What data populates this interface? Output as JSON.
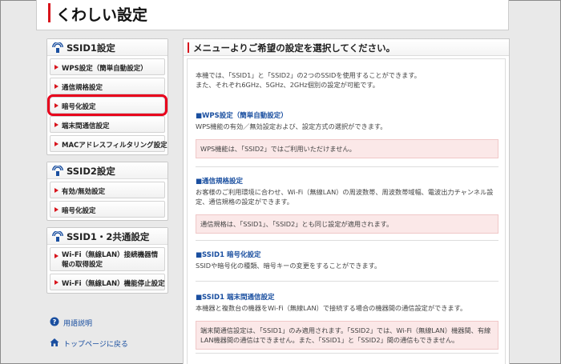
{
  "header": {
    "title": "くわしい設定"
  },
  "sidebar": {
    "ssid1": {
      "title": "SSID1設定",
      "items": [
        "WPS設定（簡単自動設定）",
        "通信規格設定",
        "暗号化設定",
        "端末間通信設定",
        "MACアドレスフィルタリング設定"
      ]
    },
    "ssid2": {
      "title": "SSID2設定",
      "items": [
        "有効/無効設定",
        "暗号化設定"
      ]
    },
    "common": {
      "title": "SSID1・2共通設定",
      "items": [
        "Wi-Fi（無線LAN）接続機器情報の取得設定",
        "Wi-Fi（無線LAN）機能停止設定"
      ]
    },
    "links": {
      "glossary": "用語説明",
      "top": "トップページに戻る"
    }
  },
  "main": {
    "heading": "メニューよりご希望の設定を選択してください。",
    "intro_line1": "本機では、「SSID1」と「SSID2」の2つのSSIDを使用することができます。",
    "intro_line2": "また、それぞれ6GHz、5GHz、2GHz個別の設定が可能です。",
    "sections": [
      {
        "title": "■WPS設定（簡単自動設定）",
        "desc": "WPS機能の有効／無効設定および、設定方式の選択ができます。",
        "note": "WPS機能は、「SSID2」ではご利用いただけません。"
      },
      {
        "title": "■通信規格設定",
        "desc": "お客様のご利用環境に合わせ、Wi-Fi（無線LAN）の周波数帯、周波数帯域幅、電波出力チャンネル設定、通信規格の設定ができます。",
        "note": "通信規格は、「SSID1」、「SSID2」とも同じ設定が適用されます。"
      },
      {
        "title": "■SSID1 暗号化設定",
        "desc": "SSIDや暗号化の種類、暗号キーの変更をすることができます。"
      },
      {
        "title": "■SSID1 端末間通信設定",
        "desc": "本機器と複数台の機器をWi-Fi（無線LAN）で接続する場合の機器間の通信設定ができます。",
        "note": "端末間通信設定は、「SSID1」のみ適用されます。「SSID2」では、Wi-Fi（無線LAN）機器間、有線LAN機器間の通信はできません。また、「SSID1」と「SSID2」間の通信もできません。"
      }
    ]
  },
  "colors": {
    "accent": "#d8141c",
    "link": "#1a4fa0",
    "highlight": "#e8001c",
    "note_bg": "#fbe8e8"
  },
  "icons": {
    "panel": "wifi-icon",
    "glossary": "help-icon",
    "top": "home-icon"
  }
}
